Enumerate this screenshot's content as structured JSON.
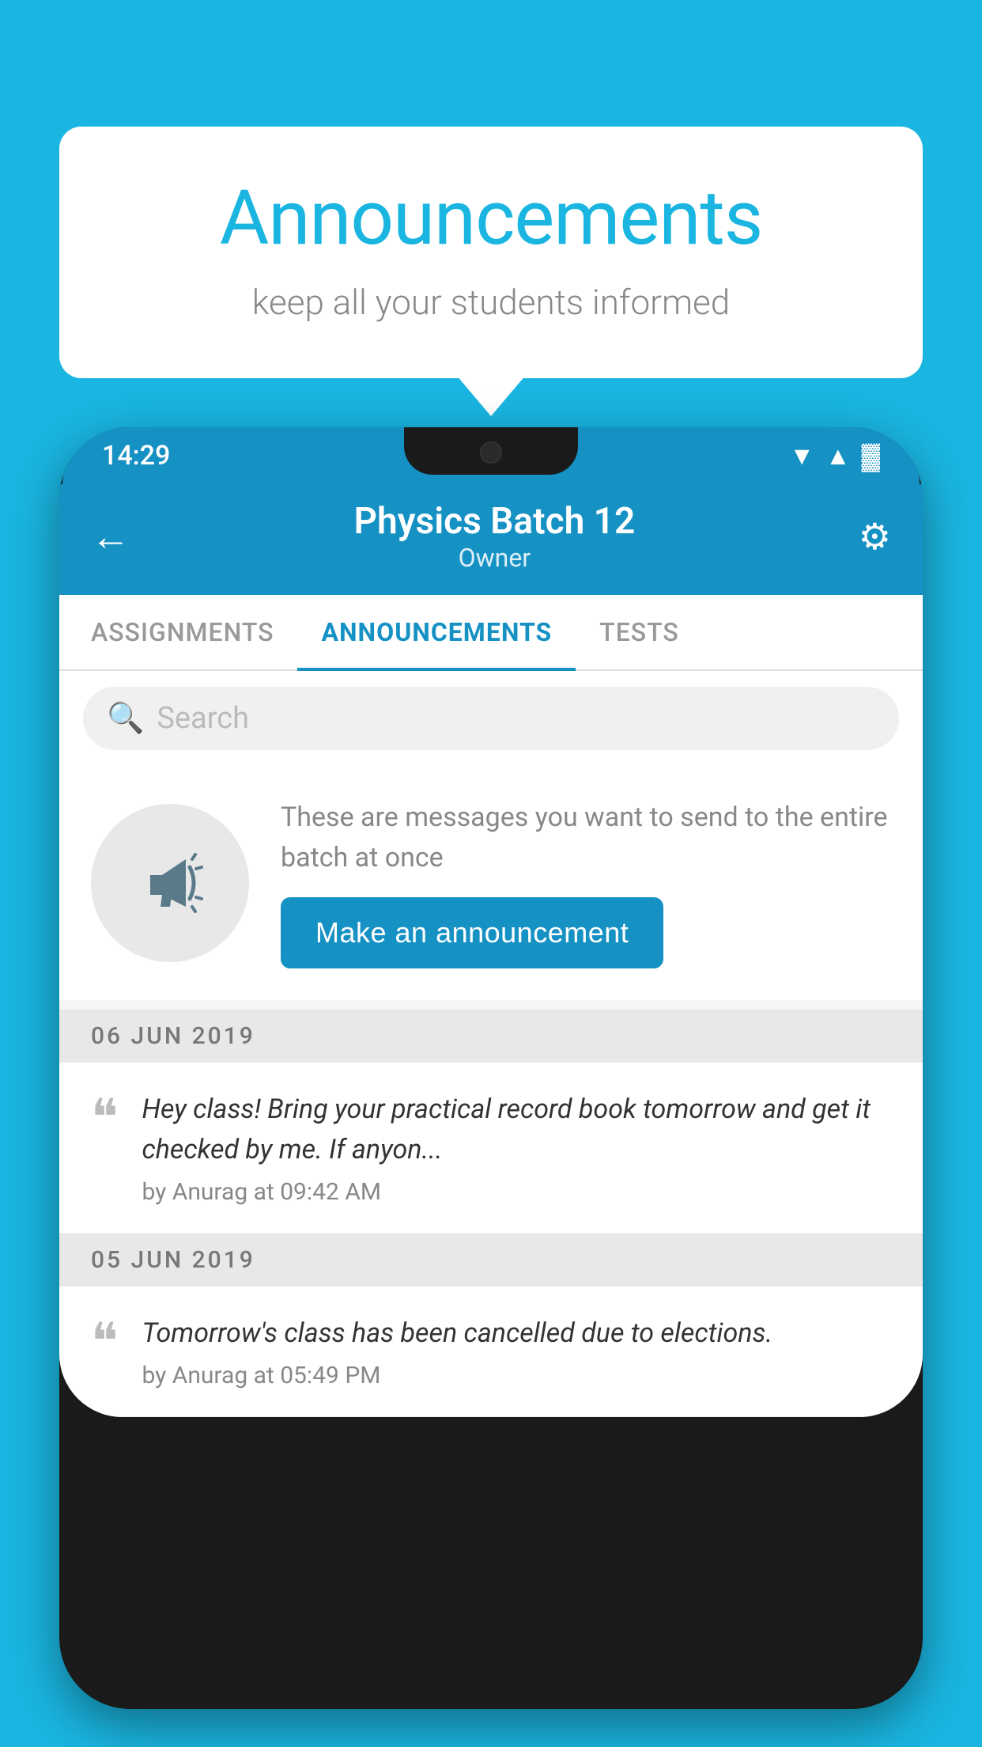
{
  "background_color": "#1ab5e0",
  "speech_bubble": {
    "title": "Announcements",
    "subtitle": "keep all your students informed"
  },
  "phone": {
    "status_bar": {
      "time": "14:29",
      "wifi": "▲",
      "signal": "▲",
      "battery": "▓"
    },
    "header": {
      "back_label": "←",
      "title": "Physics Batch 12",
      "subtitle": "Owner",
      "settings_label": "⚙"
    },
    "tabs": [
      {
        "label": "ASSIGNMENTS",
        "active": false
      },
      {
        "label": "ANNOUNCEMENTS",
        "active": true
      },
      {
        "label": "TESTS",
        "active": false
      }
    ],
    "search": {
      "placeholder": "Search"
    },
    "cta": {
      "description": "These are messages you want to send to the entire batch at once",
      "button_label": "Make an announcement"
    },
    "announcements": [
      {
        "date": "06  JUN  2019",
        "text": "Hey class! Bring your practical record book tomorrow and get it checked by me. If anyon...",
        "meta": "by Anurag at 09:42 AM"
      },
      {
        "date": "05  JUN  2019",
        "text": "Tomorrow's class has been cancelled due to elections.",
        "meta": "by Anurag at 05:49 PM"
      }
    ]
  }
}
